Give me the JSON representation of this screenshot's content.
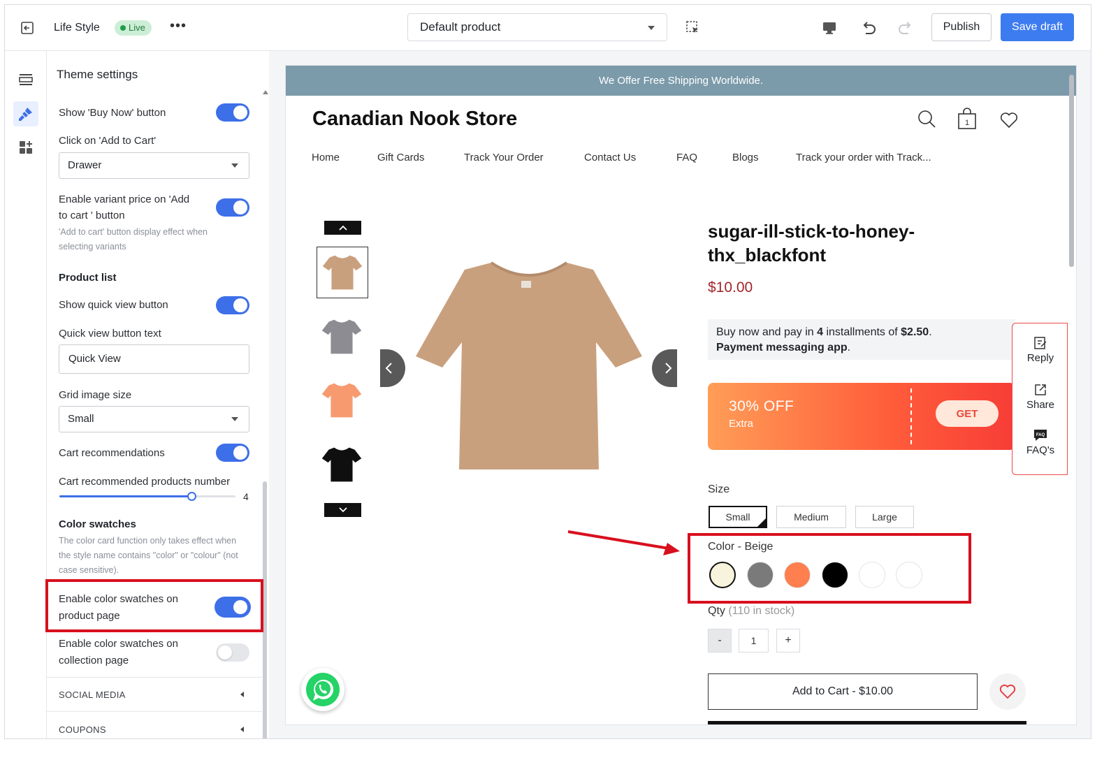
{
  "topbar": {
    "theme_name": "Life Style",
    "status": "Live",
    "more": "•••",
    "template_select": "Default product",
    "publish_label": "Publish",
    "save_label": "Save draft"
  },
  "panel": {
    "title": "Theme settings",
    "buy_now_label": "Show 'Buy Now' button",
    "buy_now_on": true,
    "add_to_cart_click_label": "Click on 'Add to Cart'",
    "add_to_cart_click_value": "Drawer",
    "variant_price_label_1": "Enable variant price on 'Add",
    "variant_price_label_2": "to cart ' button",
    "variant_price_help_1": "'Add to cart' button display effect when",
    "variant_price_help_2": "selecting variants",
    "product_list_heading": "Product list",
    "quick_view_label": "Show quick view button",
    "quick_view_text_label": "Quick view button text",
    "quick_view_text_value": "Quick View",
    "grid_image_size_label": "Grid image size",
    "grid_image_size_value": "Small",
    "cart_recs_label": "Cart recommendations",
    "cart_recs_number_label": "Cart recommended products number",
    "cart_recs_number_value": "4",
    "cart_recs_number_fraction": 0.75,
    "color_swatches_heading": "Color swatches",
    "color_swatches_help_1": "The color card function only takes effect when",
    "color_swatches_help_2": "the style name contains \"color\" or \"colour\" (not",
    "color_swatches_help_3": "case sensitive).",
    "swatch_product_label_1": "Enable color swatches on",
    "swatch_product_label_2": "product page",
    "swatch_product_on": true,
    "swatch_collection_label_1": "Enable color swatches on",
    "swatch_collection_label_2": "collection page",
    "swatch_collection_on": false,
    "social_media": "SOCIAL MEDIA",
    "coupons": "COUPONS"
  },
  "preview": {
    "announcement": "We Offer Free Shipping Worldwide.",
    "store_name": "Canadian Nook Store",
    "cart_count": "1",
    "nav": [
      "Home",
      "Gift Cards",
      "Track Your Order",
      "Contact Us",
      "FAQ",
      "Blogs",
      "Track your order with Track..."
    ],
    "product_title": "sugar-ill-stick-to-honey-thx_blackfont",
    "price": "$10.00",
    "pay_line_1_a": "Buy now and pay in ",
    "pay_line_1_b": "4",
    "pay_line_1_c": " installments of ",
    "pay_line_1_d": "$2.50",
    "pay_line_1_e": ".",
    "pay_line_2_a": "Payment messaging app",
    "pay_line_2_b": ".",
    "coupon_pct": "30% OFF",
    "coupon_extra": "Extra",
    "coupon_get": "GET",
    "float_reply": "Reply",
    "float_share": "Share",
    "float_faq": "FAQ's",
    "size_label": "Size",
    "sizes": [
      "Small",
      "Medium",
      "Large"
    ],
    "color_label": "Color",
    "color_sep": " - ",
    "color_value": "Beige",
    "swatch_colors": [
      "#f7f3dc",
      "#7a7a7a",
      "#ff7f4e",
      "#000000",
      "#ffffff",
      "#ffffff"
    ],
    "qty_label": "Qty",
    "qty_stock": "(110 in stock)",
    "qty_minus": "-",
    "qty_value": "1",
    "qty_plus": "+",
    "add_to_cart": "Add to Cart - $10.00",
    "thumb_colors": [
      "#c9a07e",
      "#8e8c93",
      "#f79a70",
      "#0f0f0f"
    ],
    "main_shirt_color": "#c9a07e"
  },
  "colors": {
    "accent": "#3d7cf0",
    "toggle_on": "#3d6fe8",
    "highlight": "#d80f1e",
    "announcement_bg": "#7b9aaa",
    "price": "#a4262c"
  }
}
